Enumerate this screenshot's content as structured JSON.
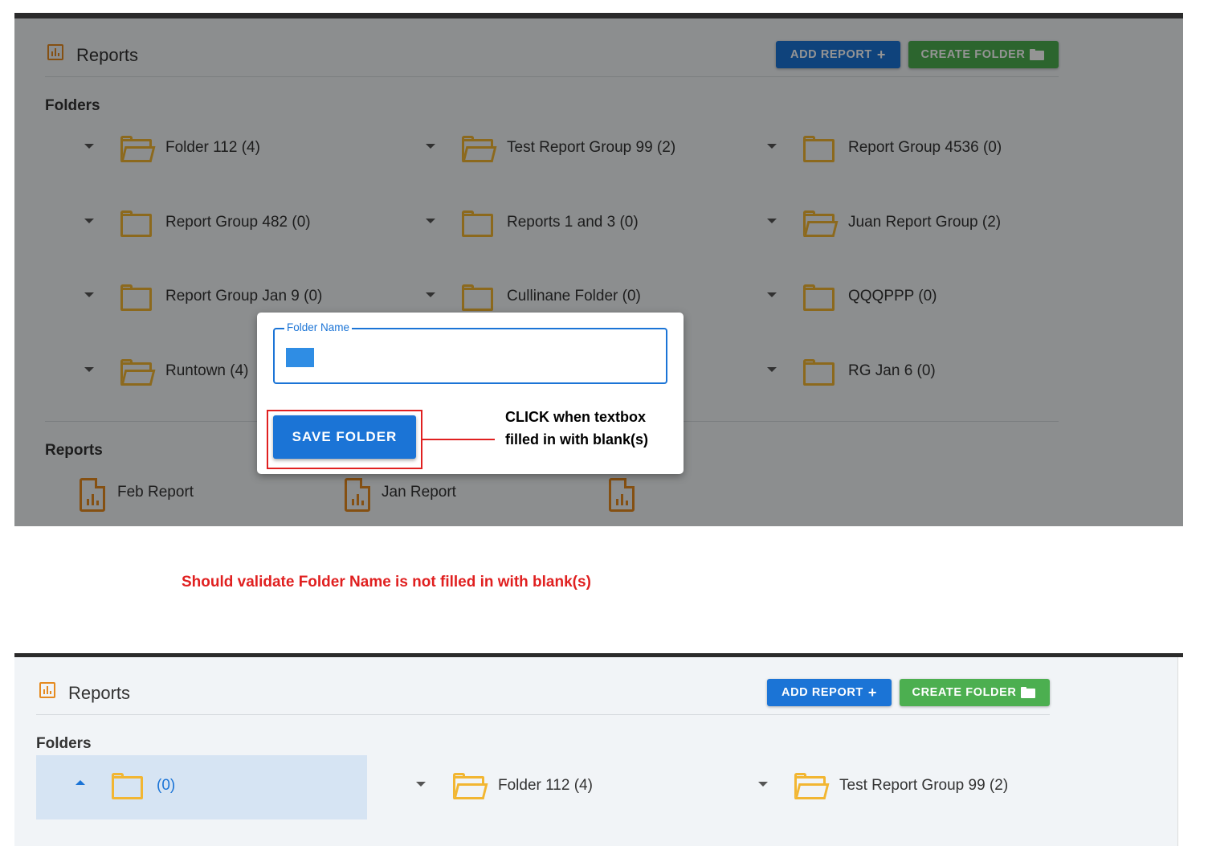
{
  "top_view": {
    "header": {
      "title": "Reports",
      "add_report_label": "ADD REPORT",
      "add_report_glyph": "+",
      "create_folder_label": "CREATE FOLDER"
    },
    "folders_label": "Folders",
    "folders": [
      {
        "name": "Folder 112 (4)",
        "icon": "folder-open-icon"
      },
      {
        "name": "Test Report Group 99 (2)",
        "icon": "folder-open-icon"
      },
      {
        "name": "Report Group 4536 (0)",
        "icon": "folder-icon"
      },
      {
        "name": "Report Group 482 (0)",
        "icon": "folder-icon"
      },
      {
        "name": "Reports 1 and 3 (0)",
        "icon": "folder-icon"
      },
      {
        "name": "Juan Report Group (2)",
        "icon": "folder-open-icon"
      },
      {
        "name": "Report Group Jan 9 (0)",
        "icon": "folder-icon"
      },
      {
        "name": "Cullinane Folder (0)",
        "icon": "folder-icon"
      },
      {
        "name": "QQQPPP (0)",
        "icon": "folder-icon"
      },
      {
        "name": "Runtown (4)",
        "icon": "folder-open-icon"
      },
      {
        "name": "RG Jan 6 (0)",
        "icon": "folder-icon"
      }
    ],
    "reports_label": "Reports",
    "reports": [
      "Feb Report",
      "Jan Report"
    ],
    "dialog": {
      "field_label": "Folder Name",
      "field_value": "",
      "save_label": "SAVE FOLDER"
    },
    "annotation": "CLICK when textbox filled in with blank(s)"
  },
  "note": "Should validate Folder Name is not filled in with blank(s)",
  "bottom_view": {
    "header": {
      "title": "Reports",
      "add_report_label": "ADD REPORT",
      "add_report_glyph": "+",
      "create_folder_label": "CREATE FOLDER"
    },
    "folders_label": "Folders",
    "folders": [
      {
        "name": "(0)",
        "selected": true
      },
      {
        "name": "Folder 112 (4)"
      },
      {
        "name": "Test Report Group 99 (2)"
      }
    ]
  },
  "colors": {
    "primary": "#1b74d6",
    "success": "#4caf50",
    "folder": "#f2b632",
    "report": "#e58a1f",
    "annotation": "#e02020"
  }
}
